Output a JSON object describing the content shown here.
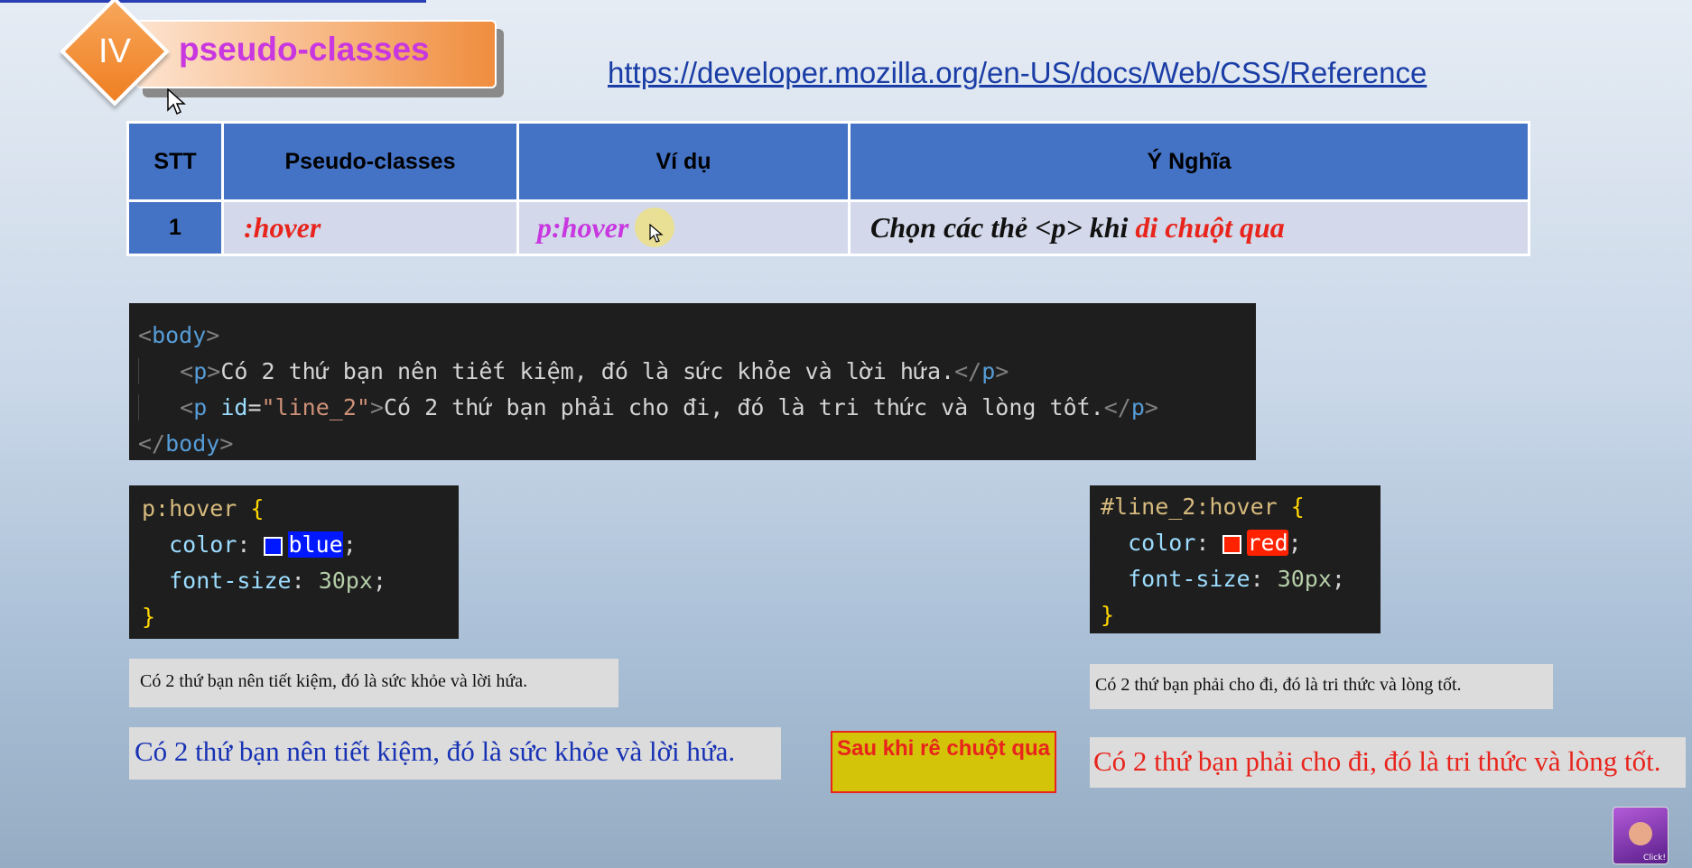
{
  "section": {
    "number": "IV",
    "title": "pseudo-classes"
  },
  "reference_link": "https://developer.mozilla.org/en-US/docs/Web/CSS/Reference",
  "table": {
    "headers": [
      "STT",
      "Pseudo-classes",
      "Ví dụ",
      "Ý Nghĩa"
    ],
    "rows": [
      {
        "stt": "1",
        "pseudo": ":hover",
        "example": "p:hover",
        "meaning_prefix": "Chọn các thẻ <p> khi ",
        "meaning_highlight": "di chuột qua"
      }
    ]
  },
  "html_code": {
    "line1_tag": "body",
    "line2_text": "Có 2 thứ bạn nên tiết kiệm, đó là sức khỏe và lời hứa.",
    "line3_attr": "id",
    "line3_value": "\"line_2\"",
    "line3_text": "Có 2 thứ bạn phải cho đi, đó là tri thức và lòng tốt.",
    "p_tag": "p"
  },
  "css_left": {
    "selector": "p:hover",
    "prop1": "color",
    "val1": "blue",
    "prop2": "font-size",
    "val2": "30px"
  },
  "css_right": {
    "selector": "#line_2:hover",
    "prop1": "color",
    "val1": "red",
    "prop2": "font-size",
    "val2": "30px"
  },
  "preview": {
    "left_normal": "Có 2 thứ bạn nên tiết kiệm, đó là sức khỏe và lời hứa.",
    "right_normal": "Có 2 thứ bạn phải cho đi, đó là tri thức và lòng tốt.",
    "left_hover": "Có 2 thứ bạn nên tiết kiệm, đó là sức khỏe và lời hứa.",
    "right_hover": "Có 2 thứ bạn phải cho đi, đó là tri thức và lòng tốt."
  },
  "after_hover_label": "Sau khi rê chuột qua",
  "avatar_label": "Click!",
  "colors": {
    "header_blue": "#4472c4",
    "row_bg": "#d3d9ea",
    "accent_red": "#e8241c",
    "accent_purple": "#c837e0",
    "hover_blue": "#1832b4"
  }
}
